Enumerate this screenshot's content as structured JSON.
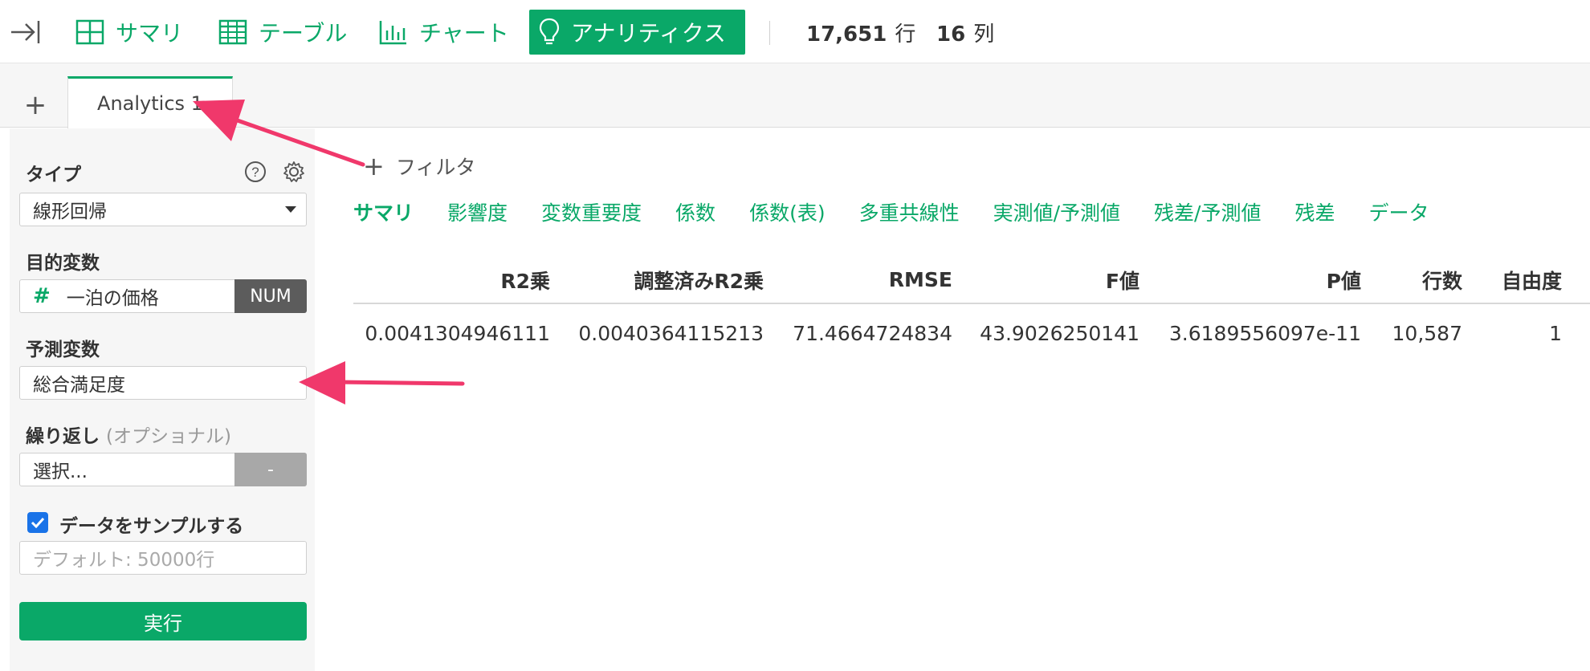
{
  "toolbar": {
    "buttons": [
      {
        "label": "サマリ",
        "icon": "grid-2x2-icon"
      },
      {
        "label": "テーブル",
        "icon": "table-icon"
      },
      {
        "label": "チャート",
        "icon": "bar-chart-icon"
      },
      {
        "label": "アナリティクス",
        "icon": "lightbulb-icon",
        "active": true
      }
    ],
    "rows_value": "17,651",
    "rows_unit": "行",
    "cols_value": "16",
    "cols_unit": "列"
  },
  "tabs": {
    "add": "+",
    "active_tab": "Analytics 1"
  },
  "panel": {
    "type_label": "タイプ",
    "type_value": "線形回帰",
    "target_label": "目的変数",
    "target_hash": "#",
    "target_value": "一泊の価格",
    "target_badge": "NUM",
    "predictor_label": "予測変数",
    "predictor_value": "総合満足度",
    "repeat_label": "繰り返し",
    "repeat_optional": "(オプショナル)",
    "repeat_placeholder": "選択...",
    "repeat_badge": "-",
    "sample_label": "データをサンプルする",
    "sample_checked": true,
    "sample_placeholder": "デフォルト: 50000行",
    "run_label": "実行"
  },
  "main": {
    "filter_plus": "+",
    "filter_label": "フィルタ",
    "subtabs": [
      "サマリ",
      "影響度",
      "変数重要度",
      "係数",
      "係数(表)",
      "多重共線性",
      "実測値/予測値",
      "残差/予測値",
      "残差",
      "データ"
    ],
    "active_subtab": "サマリ",
    "table": {
      "headers": [
        "R2乗",
        "調整済みR2乗",
        "RMSE",
        "F値",
        "P値",
        "行数",
        "自由度"
      ],
      "rows": [
        [
          "0.0041304946111",
          "0.0040364115213",
          "71.4664724834",
          "43.9026250141",
          "3.6189556097e-11",
          "10,587",
          "1"
        ]
      ]
    }
  },
  "colors": {
    "accent": "#0aa868",
    "annotation_arrow": "#f0386b",
    "checkbox": "#1a73e8"
  }
}
